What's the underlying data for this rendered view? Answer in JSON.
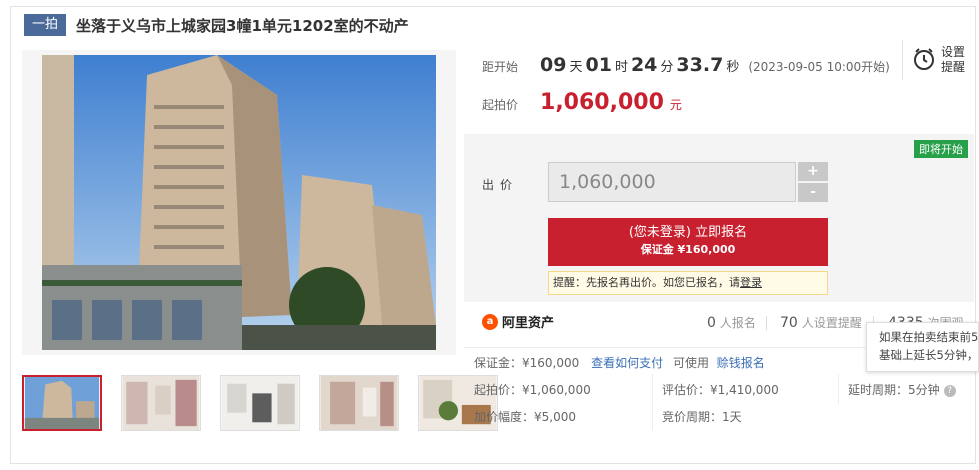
{
  "header": {
    "round_tag": "一拍",
    "title": "坐落于义乌市上城家园3幢1单元1202室的不动产"
  },
  "countdown": {
    "label": "距开始",
    "days": "09",
    "days_unit": "天",
    "hours": "01",
    "hours_unit": "时",
    "minutes": "24",
    "minutes_unit": "分",
    "seconds": "33.7",
    "seconds_unit": "秒",
    "start_time": "(2023-09-05 10:00开始)"
  },
  "starting_price": {
    "label": "起拍价",
    "value": "1,060,000",
    "unit": "元"
  },
  "reminder": {
    "line1": "设置",
    "line2": "提醒",
    "icon": "alarm-clock-icon"
  },
  "bid": {
    "status_badge": "即将开始",
    "label": "出价",
    "input_value": "1,060,000",
    "plus": "+",
    "minus": "-",
    "signup_line1": "(您未登录) 立即报名",
    "signup_line2": "保证金 ¥160,000",
    "tip_prefix": "提醒：先报名再出价。如您已报名，请",
    "tip_link": "登录"
  },
  "stats": {
    "brand": "阿里资产",
    "signups_count": "0",
    "signups_label": "人报名",
    "reminders_count": "70",
    "reminders_label": "人设置提醒",
    "views_count": "4335",
    "views_label": "次围观"
  },
  "details": {
    "deposit": "保证金：¥160,000",
    "how_to_pay": "查看如何支付",
    "can_use": "可使用",
    "credit_signup": "赊钱报名",
    "start_price": "起拍价：¥1,060,000",
    "appraisal": "评估价：¥1,410,000",
    "extension": "延时周期：5分钟",
    "increment": "加价幅度：¥5,000",
    "bid_period": "竞价周期：1天"
  },
  "tooltip": {
    "line1": "如果在拍卖结束前5",
    "line2": "基础上延长5分钟，"
  },
  "colors": {
    "accent_red": "#c8202f",
    "tag_blue": "#4a6a9a",
    "badge_green": "#27a04a",
    "link_blue": "#3b6fb6"
  }
}
